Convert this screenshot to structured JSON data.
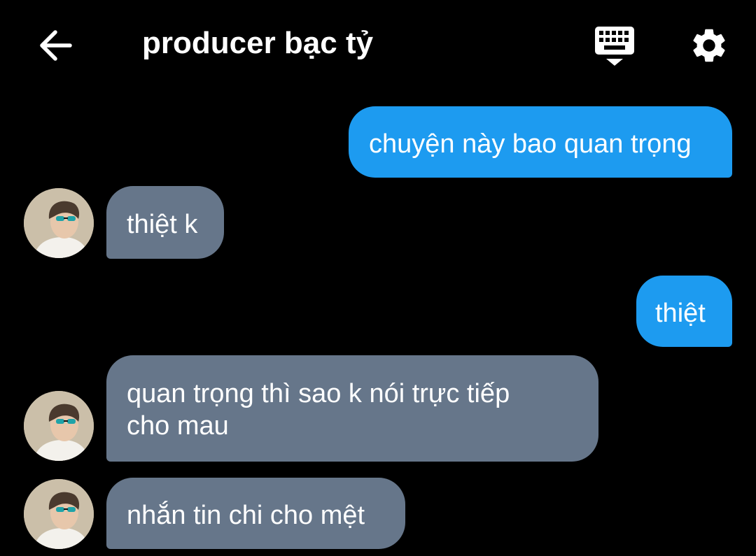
{
  "header": {
    "title": "producer bạc tỷ"
  },
  "messages": [
    {
      "direction": "sent",
      "text": "chuyện này bao quan trọng"
    },
    {
      "direction": "received",
      "text": "thiệt k"
    },
    {
      "direction": "sent",
      "text": "thiệt"
    },
    {
      "direction": "received",
      "line1": "quan trọng thì sao k nói trực tiếp",
      "line2": "cho mau"
    },
    {
      "direction": "received",
      "text": "nhắn tin chi cho mệt"
    }
  ],
  "colors": {
    "background": "#000000",
    "sent_bubble": "#1d9bf0",
    "received_bubble": "#66768a",
    "text": "#ffffff"
  },
  "icons": [
    "back-arrow-icon",
    "keyboard-icon",
    "gear-icon"
  ]
}
